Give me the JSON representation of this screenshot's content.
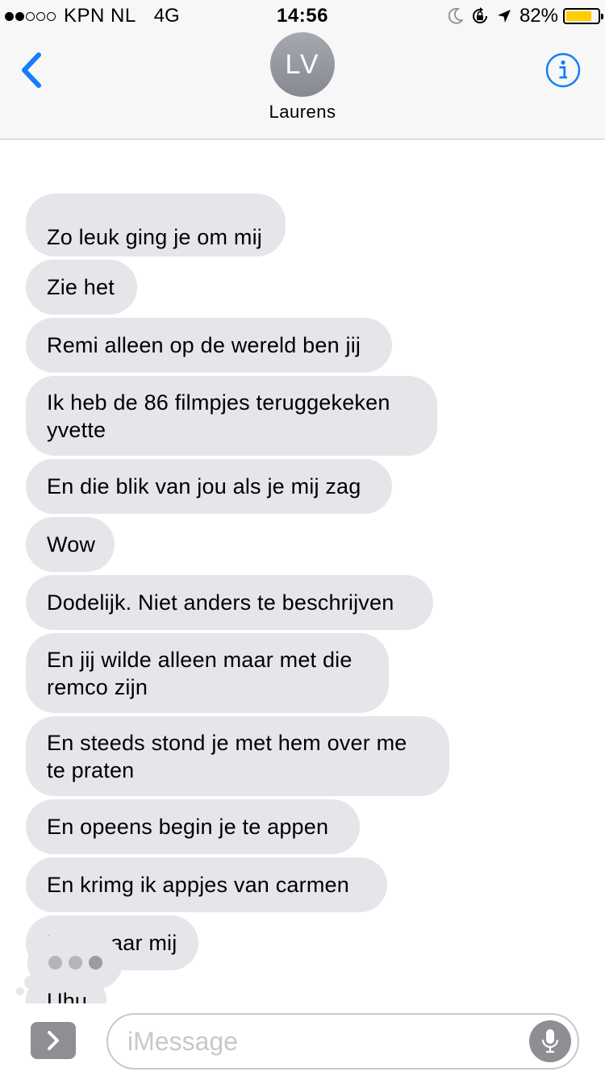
{
  "status_bar": {
    "carrier": "KPN NL",
    "network": "4G",
    "time": "14:56",
    "battery_percent": "82%",
    "battery_level": 0.82,
    "signal_strength": 2,
    "signal_max": 5,
    "icons": [
      "moon-icon",
      "rotation-lock-icon",
      "location-arrow-icon"
    ]
  },
  "nav": {
    "back_icon": "chevron-left-icon",
    "avatar_initials": "LV",
    "contact_name": "Laurens",
    "info_icon": "info-icon"
  },
  "messages": [
    {
      "text": "Zo leuk ging je om mij"
    },
    {
      "text": "Zie het"
    },
    {
      "text": "Remi alleen op de wereld ben jij"
    },
    {
      "lines": [
        "Ik heb de 86 filmpjes teruggekeken",
        "yvette"
      ]
    },
    {
      "text": "En die blik van jou als je mij zag"
    },
    {
      "text": "Wow"
    },
    {
      "text": "Dodelijk. Niet anders te beschrijven"
    },
    {
      "lines": [
        "En jij wilde alleen maar met die",
        "remco zijn"
      ]
    },
    {
      "lines": [
        "En steeds stond je met hem over me",
        "te praten"
      ]
    },
    {
      "text": "En opeens begin je te appen"
    },
    {
      "text": "En krimg ik appjes van carmen"
    },
    {
      "text": "Kom naar mij"
    },
    {
      "text": "Uhu"
    }
  ],
  "input": {
    "placeholder": "iMessage",
    "apps_icon": "chevron-right-icon",
    "mic_icon": "microphone-icon"
  },
  "colors": {
    "accent": "#157efb",
    "bubble_received": "#e5e5ea",
    "battery": "#ffcc00"
  }
}
